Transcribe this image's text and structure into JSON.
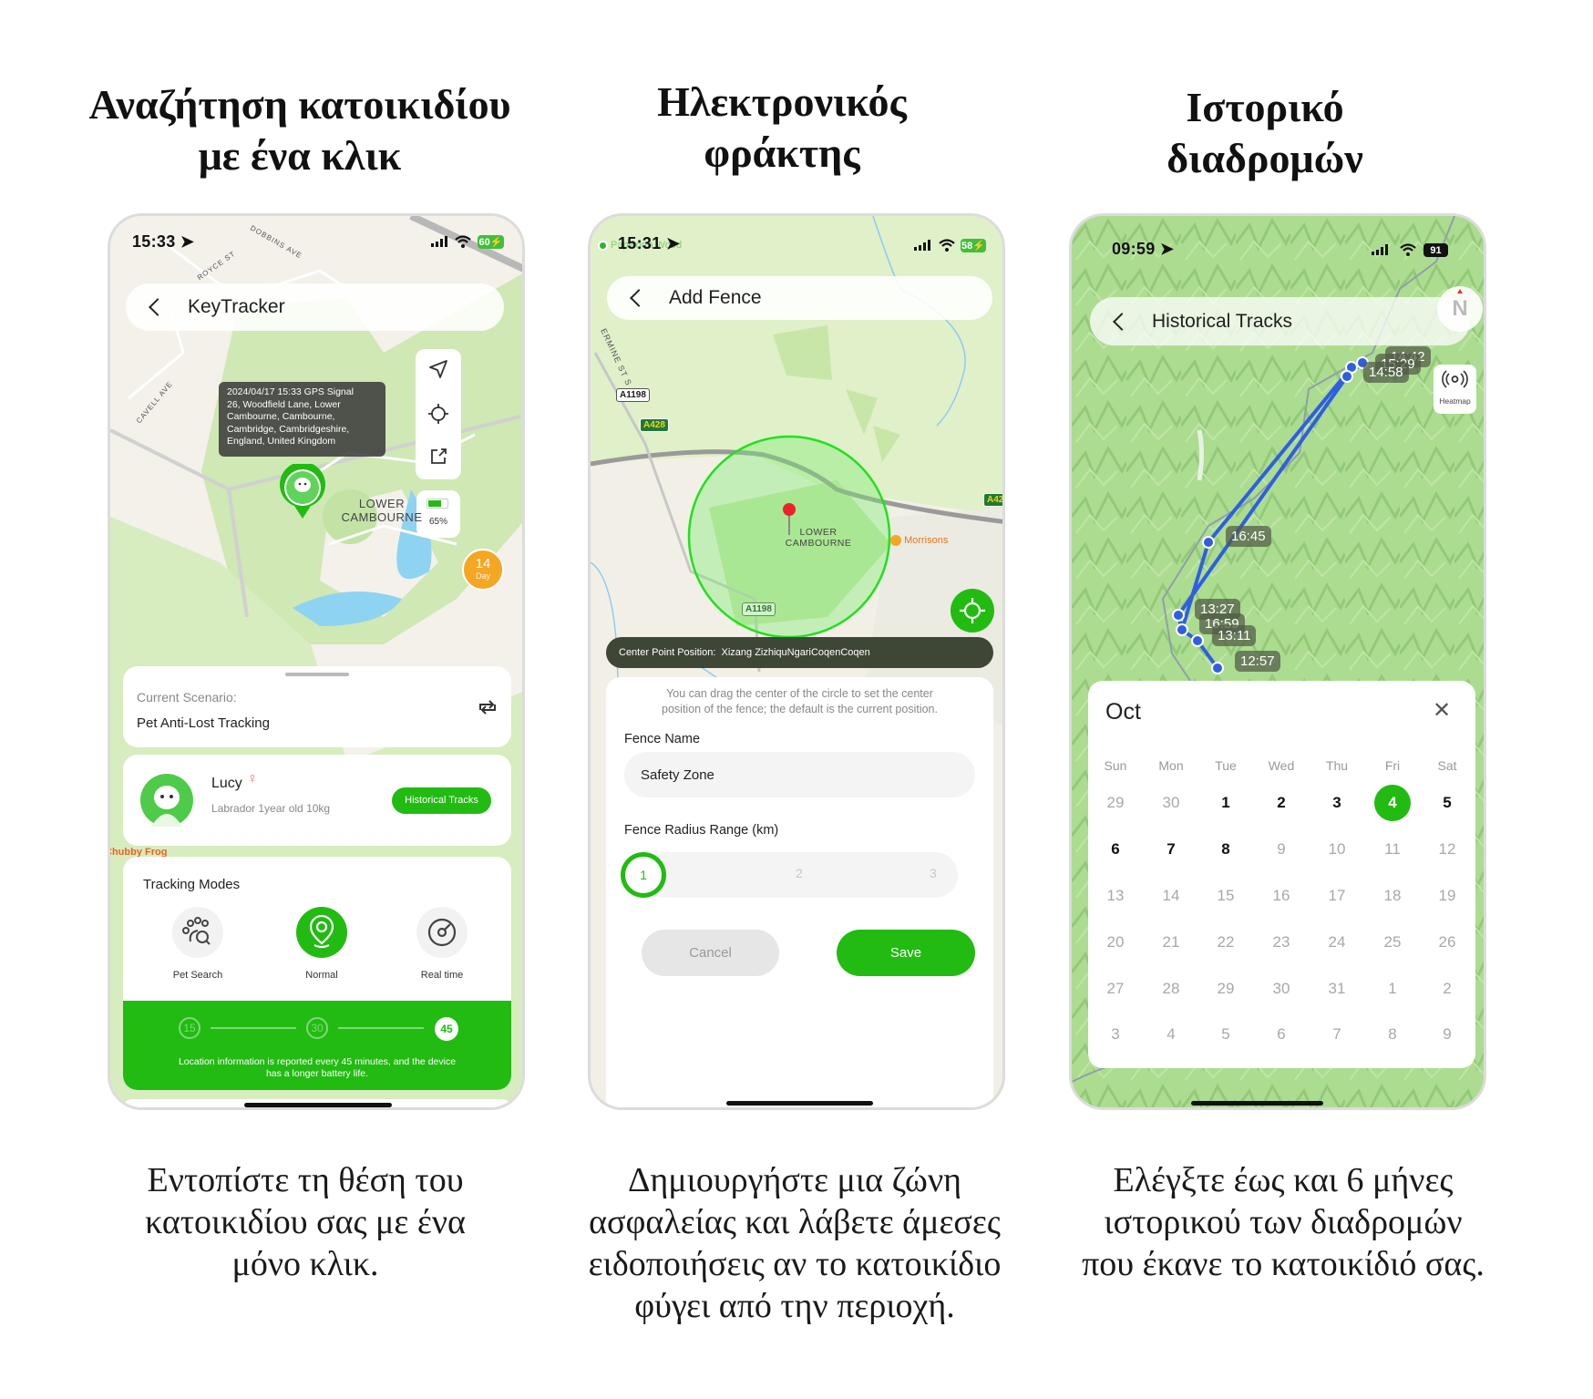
{
  "colors": {
    "brand_green": "#22bb12",
    "track_blue": "#2f5fe0",
    "orange": "#f5a623"
  },
  "panels": [
    {
      "heading": [
        "Αναζήτηση κατοικιδίου",
        "με ένα κλικ"
      ],
      "caption": [
        "Εντοπίστε τη θέση του",
        "κατοικιδίου σας με ένα",
        "μόνο κλικ."
      ]
    },
    {
      "heading": [
        "Ηλεκτρονικός",
        "φράκτης"
      ],
      "caption": [
        "Δημιουργήστε μια ζώνη",
        "ασφαλείας και λάβετε άμεσες",
        "ειδοποιήσεις αν το κατοικίδιο",
        "φύγει από την περιοχή."
      ]
    },
    {
      "heading": [
        "Ιστορικό",
        "διαδρομών"
      ],
      "caption": [
        "Ελέγξτε έως και 6 μήνες",
        "ιστορικού των διαδρομών",
        "που έκανε το κατοικίδιό σας."
      ]
    }
  ],
  "phone1": {
    "status": {
      "time": "15:33",
      "battery": "60"
    },
    "title": "KeyTracker",
    "map_labels": {
      "street1": "DOBBINS AVE",
      "street2": "ROYCE ST",
      "street3": "CAVELL AVE",
      "area": [
        "LOWER",
        "CAMBOURNE"
      ],
      "poi": "Chubby Frog"
    },
    "tooltip": [
      "2024/04/17 15:33 GPS Signal",
      "26, Woodfield Lane, Lower",
      "Cambourne, Cambourne,",
      "Cambridge, Cambridgeshire,",
      "England, United Kingdom"
    ],
    "device_battery": "65%",
    "device_battery_level": 0.65,
    "days": {
      "value": "14",
      "unit": "Day"
    },
    "scenario": {
      "label": "Current Scenario:",
      "value": "Pet Anti-Lost Tracking"
    },
    "pet": {
      "name": "Lucy",
      "details": "Labrador 1year old 10kg",
      "tracks_button": "Historical Tracks"
    },
    "modes": {
      "title": "Tracking Modes",
      "items": [
        "Pet Search",
        "Normal",
        "Real time"
      ],
      "selected": "Normal"
    },
    "intervals": {
      "steps": [
        "15",
        "30",
        "45"
      ],
      "selected": "45",
      "note": [
        "Location information is reported every 45 minutes, and the device",
        "has a longer battery life."
      ]
    }
  },
  "phone2": {
    "status": {
      "time": "15:31",
      "location": "Papworth Wood",
      "battery": "58"
    },
    "title": "Add Fence",
    "map_labels": {
      "street": "ERMINE ST S",
      "road1": "A1198",
      "road2": "A428",
      "road3": "A1198",
      "road4": "A42",
      "area": [
        "LOWER",
        "CAMBOURNE"
      ],
      "poi": "Morrisons"
    },
    "center_point": "Center Point Position:  Xizang ZizhiquNgariCoqenCoqen",
    "hint": [
      "You can drag the center of the circle to set the center",
      "position of the fence; the default is the current position."
    ],
    "fence_name_label": "Fence Name",
    "fence_name_value": "Safety Zone",
    "radius_label": "Fence Radius Range (km)",
    "radius_options": [
      "1",
      "2",
      "3"
    ],
    "radius_selected": "1",
    "cancel": "Cancel",
    "save": "Save"
  },
  "phone3": {
    "status": {
      "time": "09:59",
      "battery": "91"
    },
    "title": "Historical Tracks",
    "compass": "N",
    "heatmap": "Heatmap",
    "track_times": [
      "14:42",
      "15:29",
      "14:58",
      "16:45",
      "13:27",
      "16:59",
      "13:11",
      "12:57"
    ],
    "calendar": {
      "month": "Oct",
      "weekdays": [
        "Sun",
        "Mon",
        "Tue",
        "Wed",
        "Thu",
        "Fri",
        "Sat"
      ],
      "rows": [
        [
          {
            "d": "29",
            "s": "muted"
          },
          {
            "d": "30",
            "s": "muted"
          },
          {
            "d": "1",
            "s": "active"
          },
          {
            "d": "2",
            "s": "active"
          },
          {
            "d": "3",
            "s": "active"
          },
          {
            "d": "4",
            "s": "selected"
          },
          {
            "d": "5",
            "s": "active"
          }
        ],
        [
          {
            "d": "6",
            "s": "active"
          },
          {
            "d": "7",
            "s": "active"
          },
          {
            "d": "8",
            "s": "active"
          },
          {
            "d": "9",
            "s": "muted"
          },
          {
            "d": "10",
            "s": "muted"
          },
          {
            "d": "11",
            "s": "muted"
          },
          {
            "d": "12",
            "s": "muted"
          }
        ],
        [
          {
            "d": "13",
            "s": "muted"
          },
          {
            "d": "14",
            "s": "muted"
          },
          {
            "d": "15",
            "s": "muted"
          },
          {
            "d": "16",
            "s": "muted"
          },
          {
            "d": "17",
            "s": "muted"
          },
          {
            "d": "18",
            "s": "muted"
          },
          {
            "d": "19",
            "s": "muted"
          }
        ],
        [
          {
            "d": "20",
            "s": "muted"
          },
          {
            "d": "21",
            "s": "muted"
          },
          {
            "d": "22",
            "s": "muted"
          },
          {
            "d": "23",
            "s": "muted"
          },
          {
            "d": "24",
            "s": "muted"
          },
          {
            "d": "25",
            "s": "muted"
          },
          {
            "d": "26",
            "s": "muted"
          }
        ],
        [
          {
            "d": "27",
            "s": "muted"
          },
          {
            "d": "28",
            "s": "muted"
          },
          {
            "d": "29",
            "s": "muted"
          },
          {
            "d": "30",
            "s": "muted"
          },
          {
            "d": "31",
            "s": "muted"
          },
          {
            "d": "1",
            "s": "muted"
          },
          {
            "d": "2",
            "s": "muted"
          }
        ],
        [
          {
            "d": "3",
            "s": "muted"
          },
          {
            "d": "4",
            "s": "muted"
          },
          {
            "d": "5",
            "s": "muted"
          },
          {
            "d": "6",
            "s": "muted"
          },
          {
            "d": "7",
            "s": "muted"
          },
          {
            "d": "8",
            "s": "muted"
          },
          {
            "d": "9",
            "s": "muted"
          }
        ]
      ]
    }
  }
}
